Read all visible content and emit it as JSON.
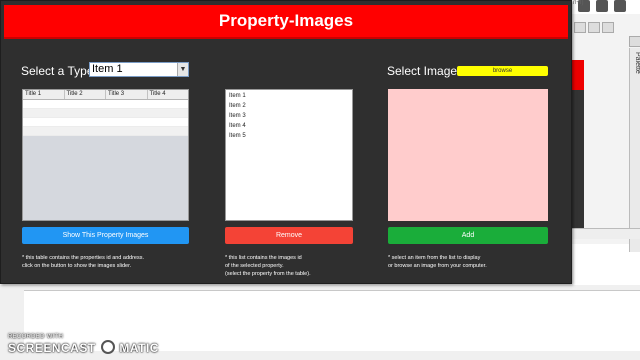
{
  "ide": {
    "shortcut_hint": "rl+I)",
    "palette_label": "Palette"
  },
  "window": {
    "title": "Property-Images"
  },
  "type_selector": {
    "label": "Select a Type:",
    "selected_value": "Item 1"
  },
  "image_selector": {
    "label": "Select Image:",
    "browse_label": "browse"
  },
  "table": {
    "columns": [
      "Title 1",
      "Title 2",
      "Title 3",
      "Title 4"
    ]
  },
  "list": {
    "items": [
      "Item 1",
      "Item 2",
      "Item 3",
      "Item 4",
      "Item 5"
    ]
  },
  "buttons": {
    "show_label": "Show This Property Images",
    "remove_label": "Remove",
    "add_label": "Add"
  },
  "notes": {
    "table_note_1": "* this table contains the properties id and address.",
    "table_note_2": "click on the button to show the images slider.",
    "list_note_1": "* this list contains the images id",
    "list_note_2": "of the selected property.",
    "list_note_3": "(select the property from the table).",
    "image_note_1": "* select an item from the list to display",
    "image_note_2": "or browse an image from your computer."
  },
  "watermark": {
    "line1": "RECORDED WITH",
    "brand_left": "SCREENCAST",
    "brand_right": "MATIC"
  },
  "colors": {
    "title_bar": "#ff0000",
    "window_bg": "#2f2f2f",
    "browse_button": "#ffff00",
    "show_button": "#2196f3",
    "remove_button": "#f44336",
    "add_button": "#1aad3a",
    "image_placeholder": "#ffcccc"
  }
}
